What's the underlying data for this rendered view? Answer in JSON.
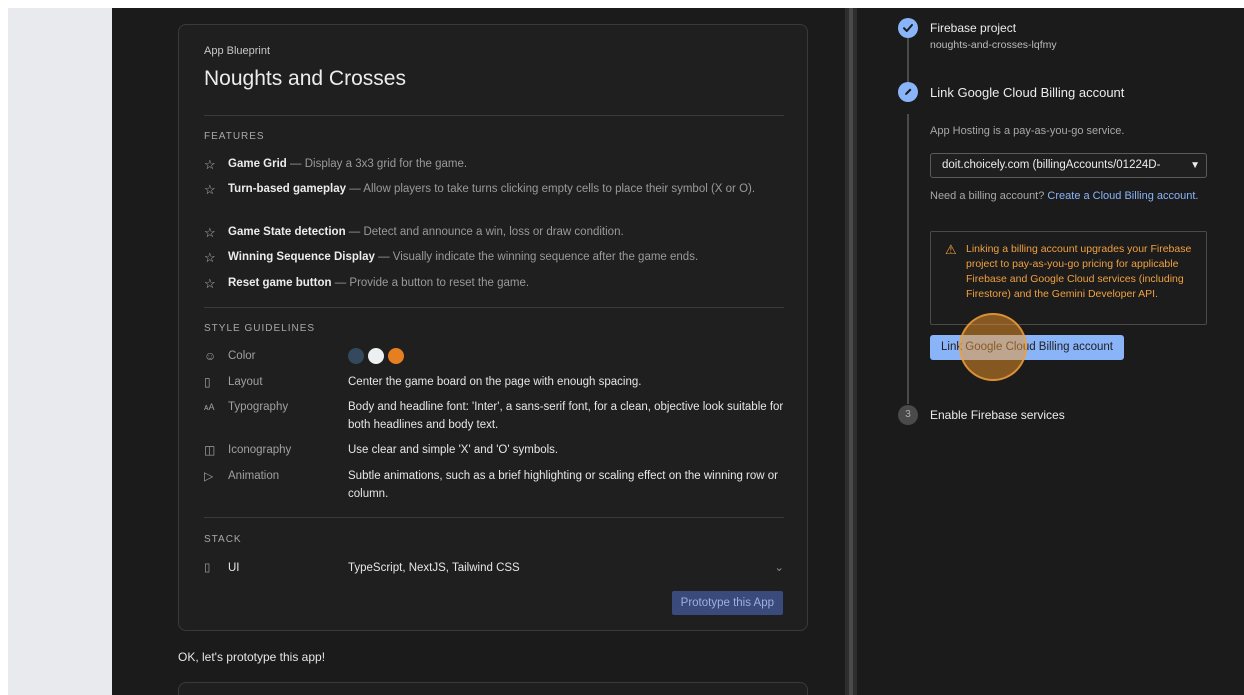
{
  "blueprint": {
    "eyebrow": "App Blueprint",
    "title": "Noughts and Crosses",
    "features_label": "FEATURES",
    "features": [
      {
        "name": "Game Grid",
        "desc": " — Display a 3x3 grid for the game."
      },
      {
        "name": "Turn-based gameplay",
        "desc": " — Allow players to take turns clicking empty cells to place their symbol (X or O)."
      },
      {
        "name": "Game State detection",
        "desc": " — Detect and announce a win, loss or draw condition."
      },
      {
        "name": "Winning Sequence Display",
        "desc": " — Visually indicate the winning sequence after the game ends."
      },
      {
        "name": "Reset game button",
        "desc": " — Provide a button to reset the game."
      }
    ],
    "style_label": "STYLE GUIDELINES",
    "style": {
      "color_label": "Color",
      "colors": [
        "#34495e",
        "#ecf0f1",
        "#e67e22"
      ],
      "layout_label": "Layout",
      "layout_value": "Center the game board on the page with enough spacing.",
      "typography_label": "Typography",
      "typography_value": "Body and headline font: 'Inter', a sans-serif font, for a clean, objective look suitable for both headlines and body text.",
      "iconography_label": "Iconography",
      "iconography_value": "Use clear and simple 'X' and 'O' symbols.",
      "animation_label": "Animation",
      "animation_value": "Subtle animations, such as a brief highlighting or scaling effect on the winning row or column."
    },
    "stack_label": "STACK",
    "stack": {
      "label": "UI",
      "value": "TypeScript, NextJS, Tailwind CSS"
    },
    "prototype_button": "Prototype this App"
  },
  "chat": {
    "ok_message": "OK, let's prototype this app!"
  },
  "setup": {
    "step1": {
      "title": "Firebase project",
      "subtitle": "noughts-and-crosses-lqfmy"
    },
    "step2": {
      "title": "Link Google Cloud Billing account",
      "note": "App Hosting is a pay-as-you-go service.",
      "select_value": "doit.choicely.com (billingAccounts/01224D-",
      "need_prefix": "Need a billing account? ",
      "need_link": "Create a Cloud Billing account.",
      "warning": "Linking a billing account upgrades your Firebase project to pay-as-you-go pricing for applicable Firebase and Google Cloud services (including Firestore) and the Gemini Developer API.",
      "link_button": "Link Google Cloud Billing account"
    },
    "step3": {
      "number": "3",
      "title": "Enable Firebase services"
    }
  },
  "colors": {
    "accent": "#8ab4f8",
    "warning": "#f0a040",
    "background": "#1b1b1b"
  }
}
